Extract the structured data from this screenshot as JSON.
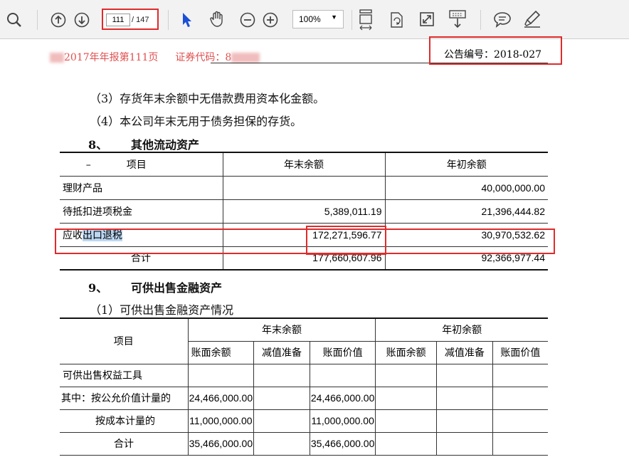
{
  "toolbar": {
    "icons": [
      "search-icon",
      "arrow-up-icon",
      "arrow-down-icon",
      "select-cursor-icon",
      "hand-icon",
      "zoom-out-icon",
      "zoom-in-icon",
      "fit-page-icon",
      "rotate-icon",
      "fullscreen-icon",
      "read-mode-icon",
      "comment-icon",
      "highlighter-icon"
    ],
    "page_current": "111",
    "page_total": "/ 147",
    "zoom": "100%"
  },
  "header": {
    "report_title": "2017年年报第111页",
    "stock_code_label": "证券代码：8",
    "notice_number": "公告编号：2018-027"
  },
  "paragraphs": {
    "p3": "（3）存货年末余额中无借款费用资本化金额。",
    "p4": "（4）本公司年末无用于债务担保的存货。"
  },
  "section8": {
    "num": "8、",
    "title": "其他流动资产",
    "headers": [
      "项目",
      "年末余额",
      "年初余额"
    ],
    "rows": [
      {
        "item": "理财产品",
        "end": "",
        "begin": "40,000,000.00"
      },
      {
        "item": "待抵扣进项税金",
        "end": "5,389,011.19",
        "begin": "21,396,444.82"
      },
      {
        "item_a": "应收",
        "item_b": "出口退税",
        "end": "172,271,596.77",
        "begin": "30,970,532.62"
      },
      {
        "item": "合计",
        "end": "177,660,607.96",
        "begin": "92,366,977.44"
      }
    ]
  },
  "section9": {
    "num": "9、",
    "title": "可供出售金融资产",
    "sub": "（1）可供出售金融资产情况",
    "head_item": "项目",
    "group_end": "年末余额",
    "group_begin": "年初余额",
    "sub_headers": [
      "账面余额",
      "减值准备",
      "账面价值",
      "账面余额",
      "减值准备",
      "账面价值"
    ],
    "rows": [
      {
        "item": "可供出售权益工具",
        "c1": "",
        "c2": "",
        "c3": "",
        "c4": "",
        "c5": "",
        "c6": ""
      },
      {
        "item": "其中：按公允价值计量的",
        "c1": "24,466,000.00",
        "c2": "",
        "c3": "24,466,000.00",
        "c4": "",
        "c5": "",
        "c6": ""
      },
      {
        "item": "按成本计量的",
        "c1": "11,000,000.00",
        "c2": "",
        "c3": "11,000,000.00",
        "c4": "",
        "c5": "",
        "c6": ""
      },
      {
        "item": "合计",
        "c1": "35,466,000.00",
        "c2": "",
        "c3": "35,466,000.00",
        "c4": "",
        "c5": "",
        "c6": ""
      }
    ]
  },
  "colors": {
    "highlight_box": "#e02b2b",
    "selection": "#bcd7f2",
    "cursor": "#1a4fd6"
  }
}
